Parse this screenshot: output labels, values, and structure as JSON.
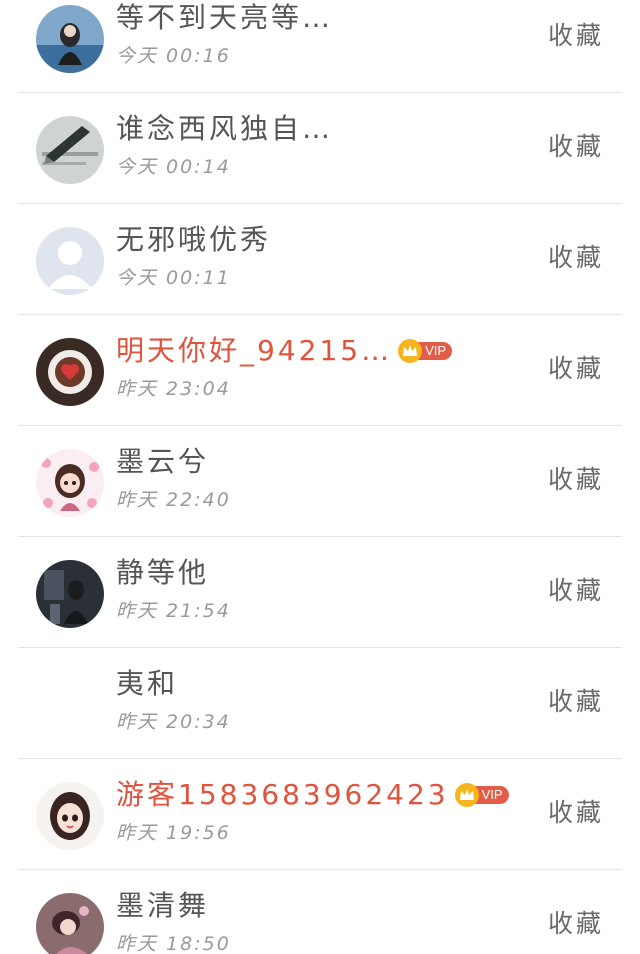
{
  "collect_label": "收藏",
  "vip_label": "VIP",
  "items": [
    {
      "name": "等不到天亮等…",
      "time": "今天 00:16",
      "vip": false,
      "avatar": "girl-seaside-avatar"
    },
    {
      "name": "谁念西风独自…",
      "time": "今天 00:14",
      "vip": false,
      "avatar": "pen-avatar"
    },
    {
      "name": "无邪哦优秀",
      "time": "今天 00:11",
      "vip": false,
      "avatar": "default-user-avatar"
    },
    {
      "name": "明天你好_94215…",
      "time": "昨天 23:04",
      "vip": true,
      "avatar": "coffee-heart-avatar"
    },
    {
      "name": "墨云兮",
      "time": "昨天 22:40",
      "vip": false,
      "avatar": "anime-girl-flowers-avatar"
    },
    {
      "name": "静等他",
      "time": "昨天 21:54",
      "vip": false,
      "avatar": "dark-scene-avatar"
    },
    {
      "name": "夷和",
      "time": "昨天 20:34",
      "vip": false,
      "avatar": "no-avatar"
    },
    {
      "name": "游客15836839624​23",
      "time": "昨天 19:56",
      "vip": true,
      "avatar": "cartoon-girl-avatar"
    },
    {
      "name": "墨清舞",
      "time": "昨天 18:50",
      "vip": false,
      "avatar": "costume-avatar"
    }
  ],
  "colors": {
    "vip_name": "#e0533d",
    "vip_badge": "#e25d47",
    "crown": "#f5b51d",
    "divider": "#e6e6e6"
  }
}
